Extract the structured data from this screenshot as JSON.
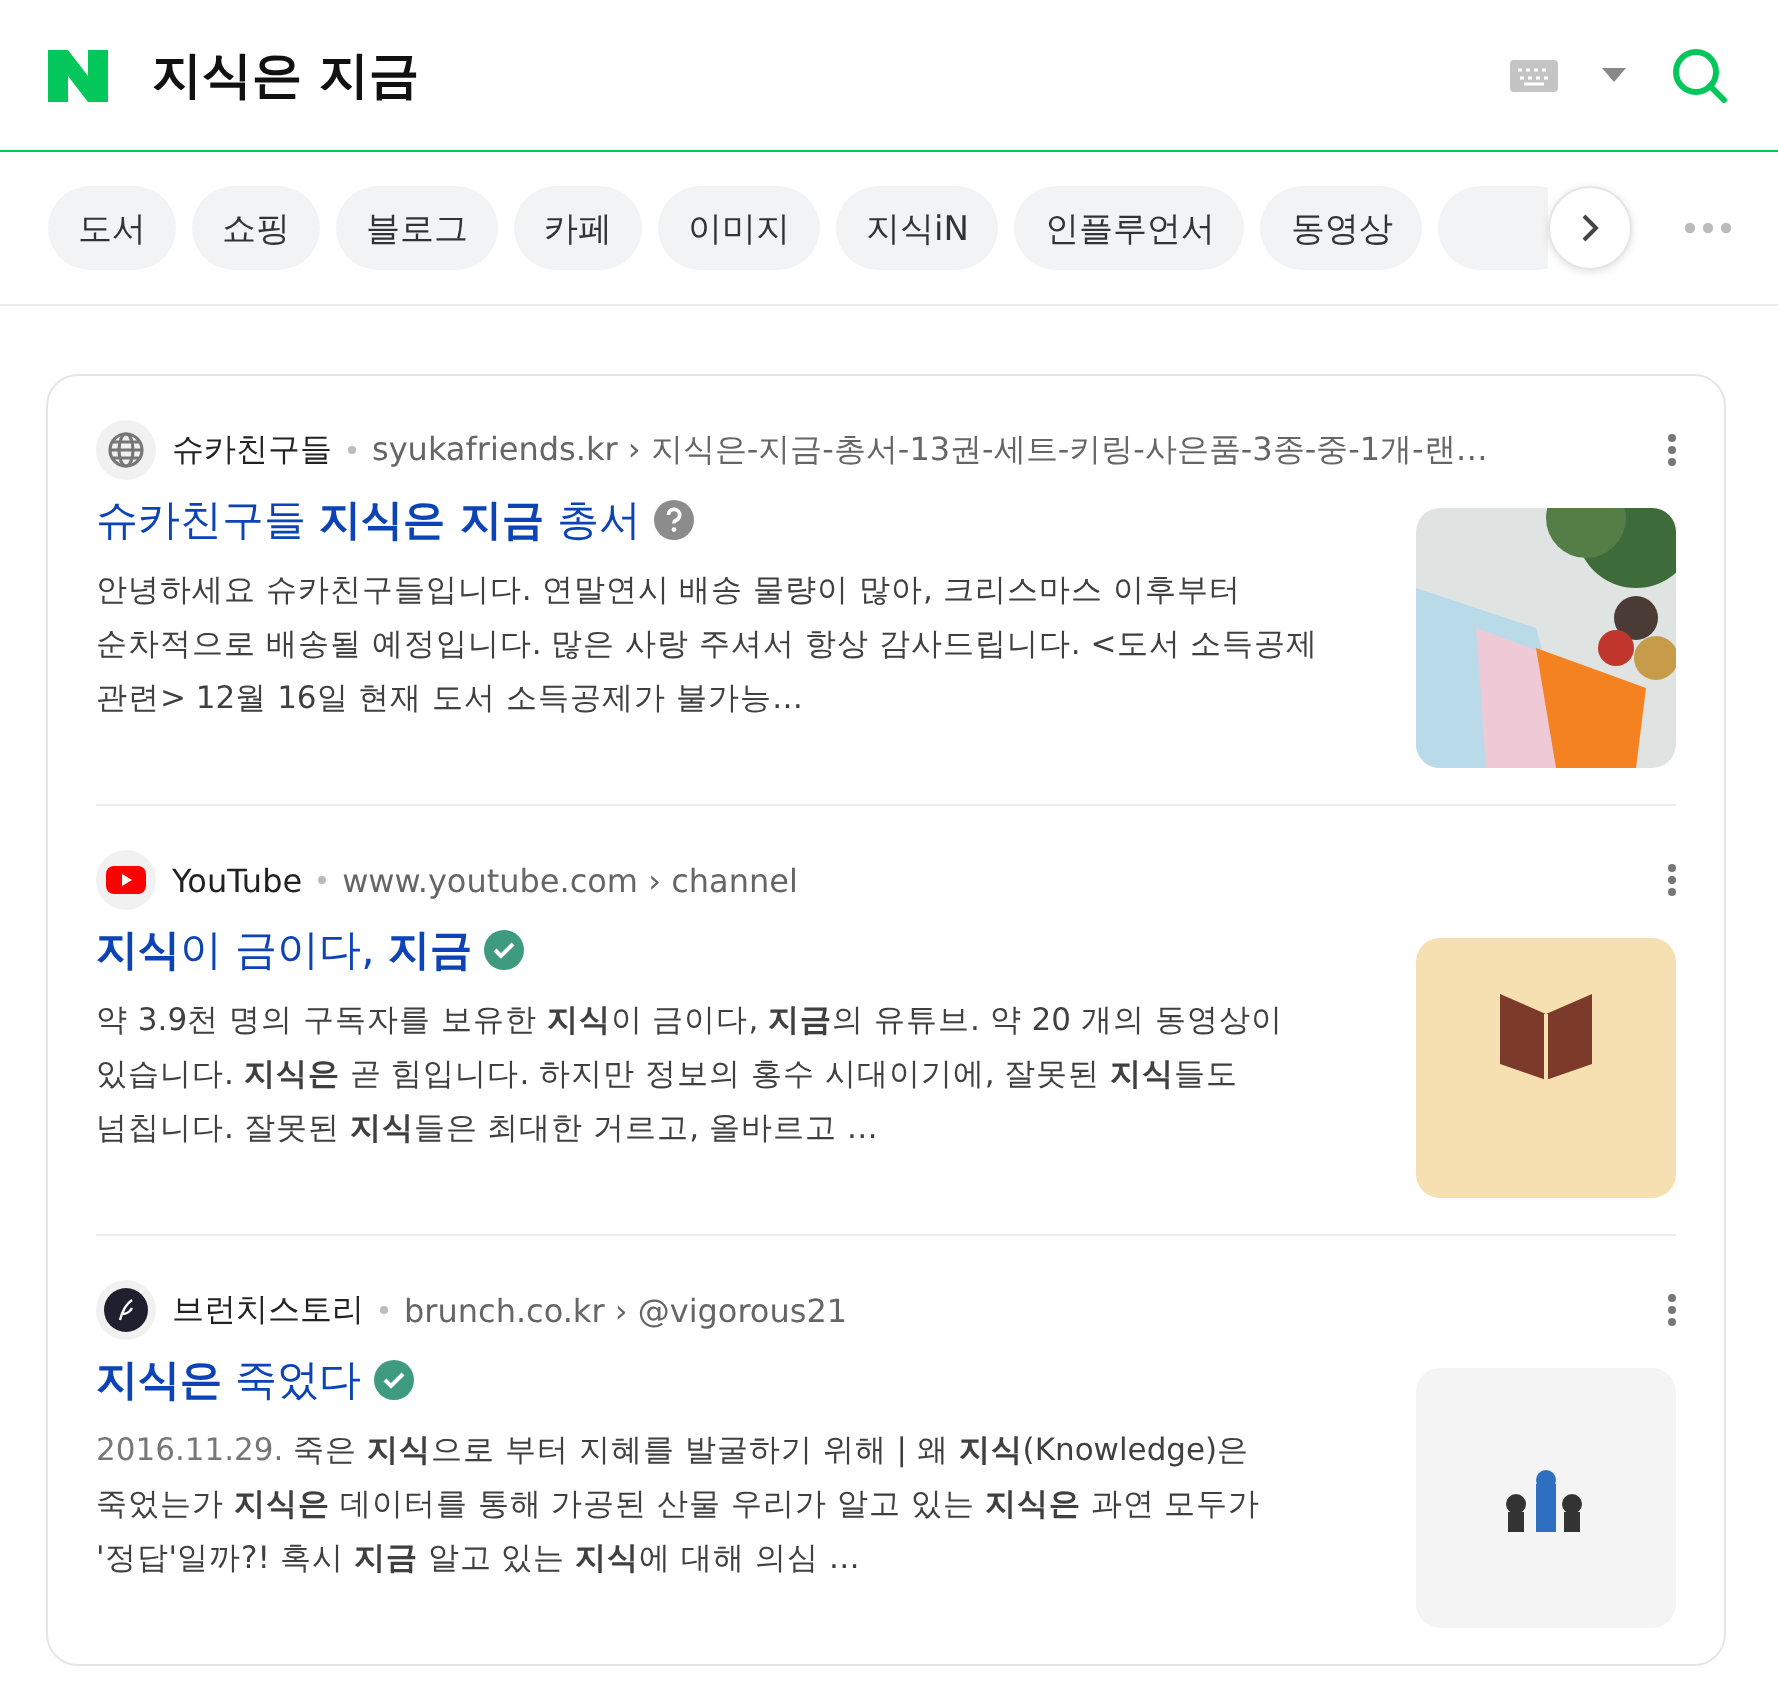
{
  "header": {
    "query": "지식은 지금"
  },
  "categories": [
    {
      "label": "도서",
      "selected": false
    },
    {
      "label": "쇼핑",
      "selected": false
    },
    {
      "label": "블로그",
      "selected": false
    },
    {
      "label": "카페",
      "selected": false
    },
    {
      "label": "이미지",
      "selected": false
    },
    {
      "label": "지식iN",
      "selected": false
    },
    {
      "label": "인플루언서",
      "selected": false
    },
    {
      "label": "동영상",
      "selected": false
    }
  ],
  "results": [
    {
      "favicon": {
        "kind": "globe"
      },
      "source": "슈카친구들",
      "url": "syukafriends.kr › 지식은-지금-총서-13권-세트-키링-사은품-3종-중-1개-랜…",
      "title": "슈카친구들 **지식은 지금** 총서",
      "badge": {
        "kind": "help"
      },
      "snippet": "안녕하세요 슈카친구들입니다. 연말연시 배송 물량이 많아, 크리스마스 이후부터 순차적으로 배송될 예정입니다. 많은 사랑 주셔서 항상 감사드립니다. <도서 소득공제 관련> 12월 16일 현재 도서 소득공제가 불가능…"
    },
    {
      "favicon": {
        "kind": "youtube"
      },
      "source": "YouTube",
      "url": "www.youtube.com › channel",
      "title": "**지식**이 금이다, **지금**",
      "badge": {
        "kind": "verified"
      },
      "snippet": "약 3.9천 명의 구독자를 보유한 **지식**이 금이다, **지금**의 유튜브. 약 20 개의 동영상이 있습니다. **지식은** 곧 힘입니다. 하지만 정보의 홍수 시대이기에, 잘못된 **지식**들도 넘칩니다. 잘못된 **지식**들은 최대한 거르고, 올바르고 …"
    },
    {
      "favicon": {
        "kind": "brunch"
      },
      "source": "브런치스토리",
      "url": "brunch.co.kr › @vigorous21",
      "title": "**지식은** 죽었다",
      "badge": {
        "kind": "verified"
      },
      "date": "2016.11.29.",
      "snippet": "죽은 **지식**으로 부터 지혜를 발굴하기 위해 | 왜 **지식**(Knowledge)은 죽었는가 **지식은** 데이터를 통해 가공된 산물 우리가 알고 있는 **지식은** 과연 모두가 '정답'일까?! 혹시 **지금** 알고 있는 **지식**에 대해 의심 …"
    }
  ]
}
